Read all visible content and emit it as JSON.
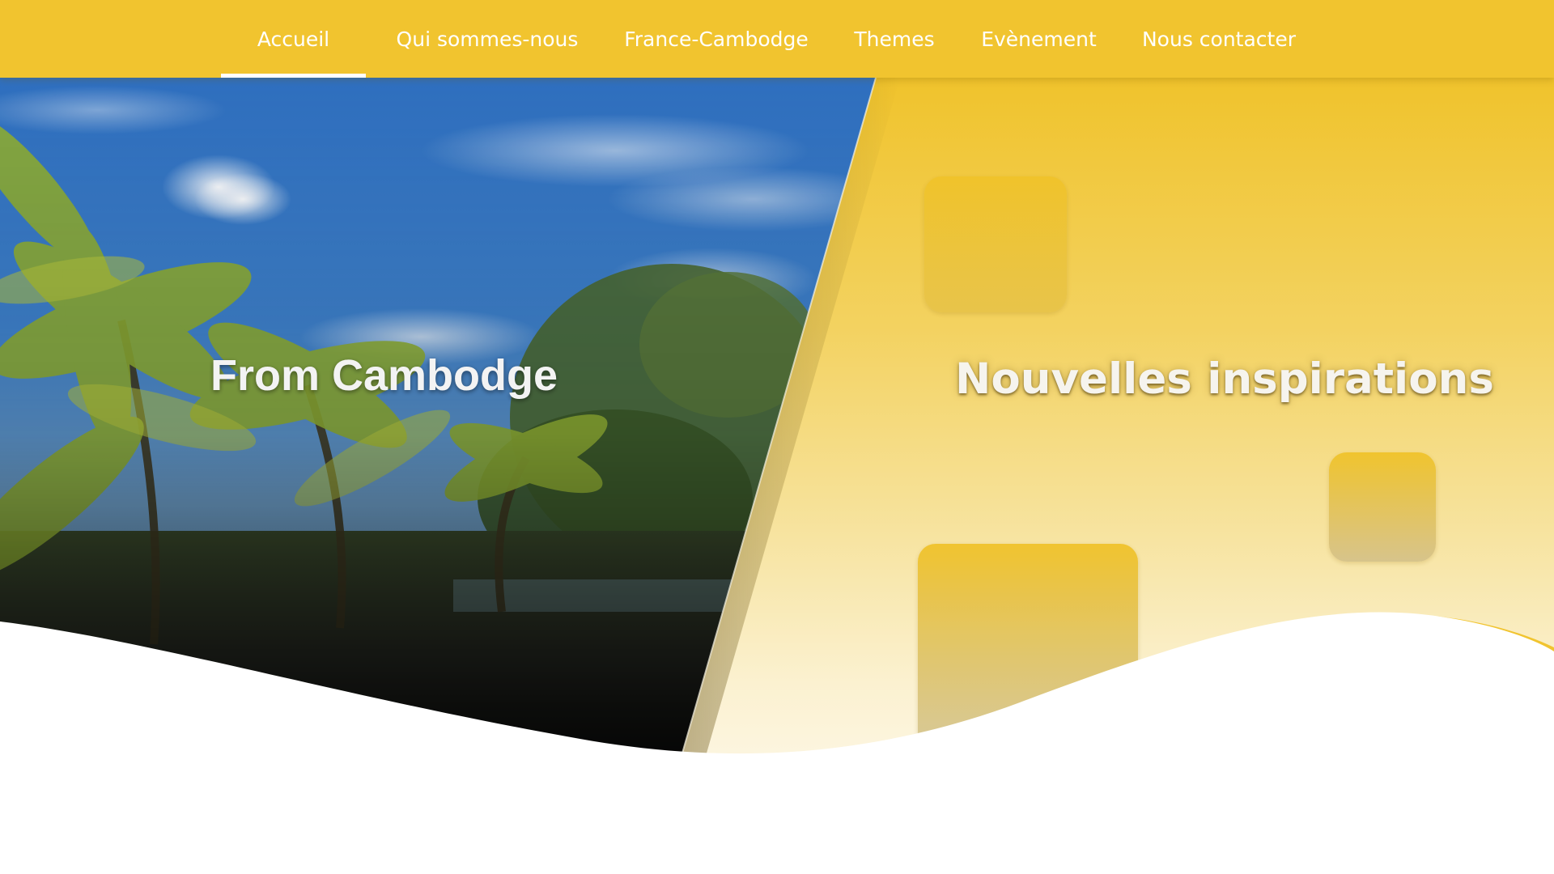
{
  "nav": {
    "items": [
      {
        "label": "Accueil",
        "active": true
      },
      {
        "label": "Qui sommes-nous",
        "active": false
      },
      {
        "label": "France-Cambodge",
        "active": false
      },
      {
        "label": "Themes",
        "active": false
      },
      {
        "label": "Evènement",
        "active": false
      },
      {
        "label": "Nous contacter",
        "active": false
      }
    ]
  },
  "hero": {
    "left_title": "From Cambodge",
    "right_title": "Nouvelles inspirations"
  },
  "colors": {
    "brand_yellow": "#f1c42f",
    "nav_text": "#ffffff",
    "page_background": "#ffffff"
  }
}
